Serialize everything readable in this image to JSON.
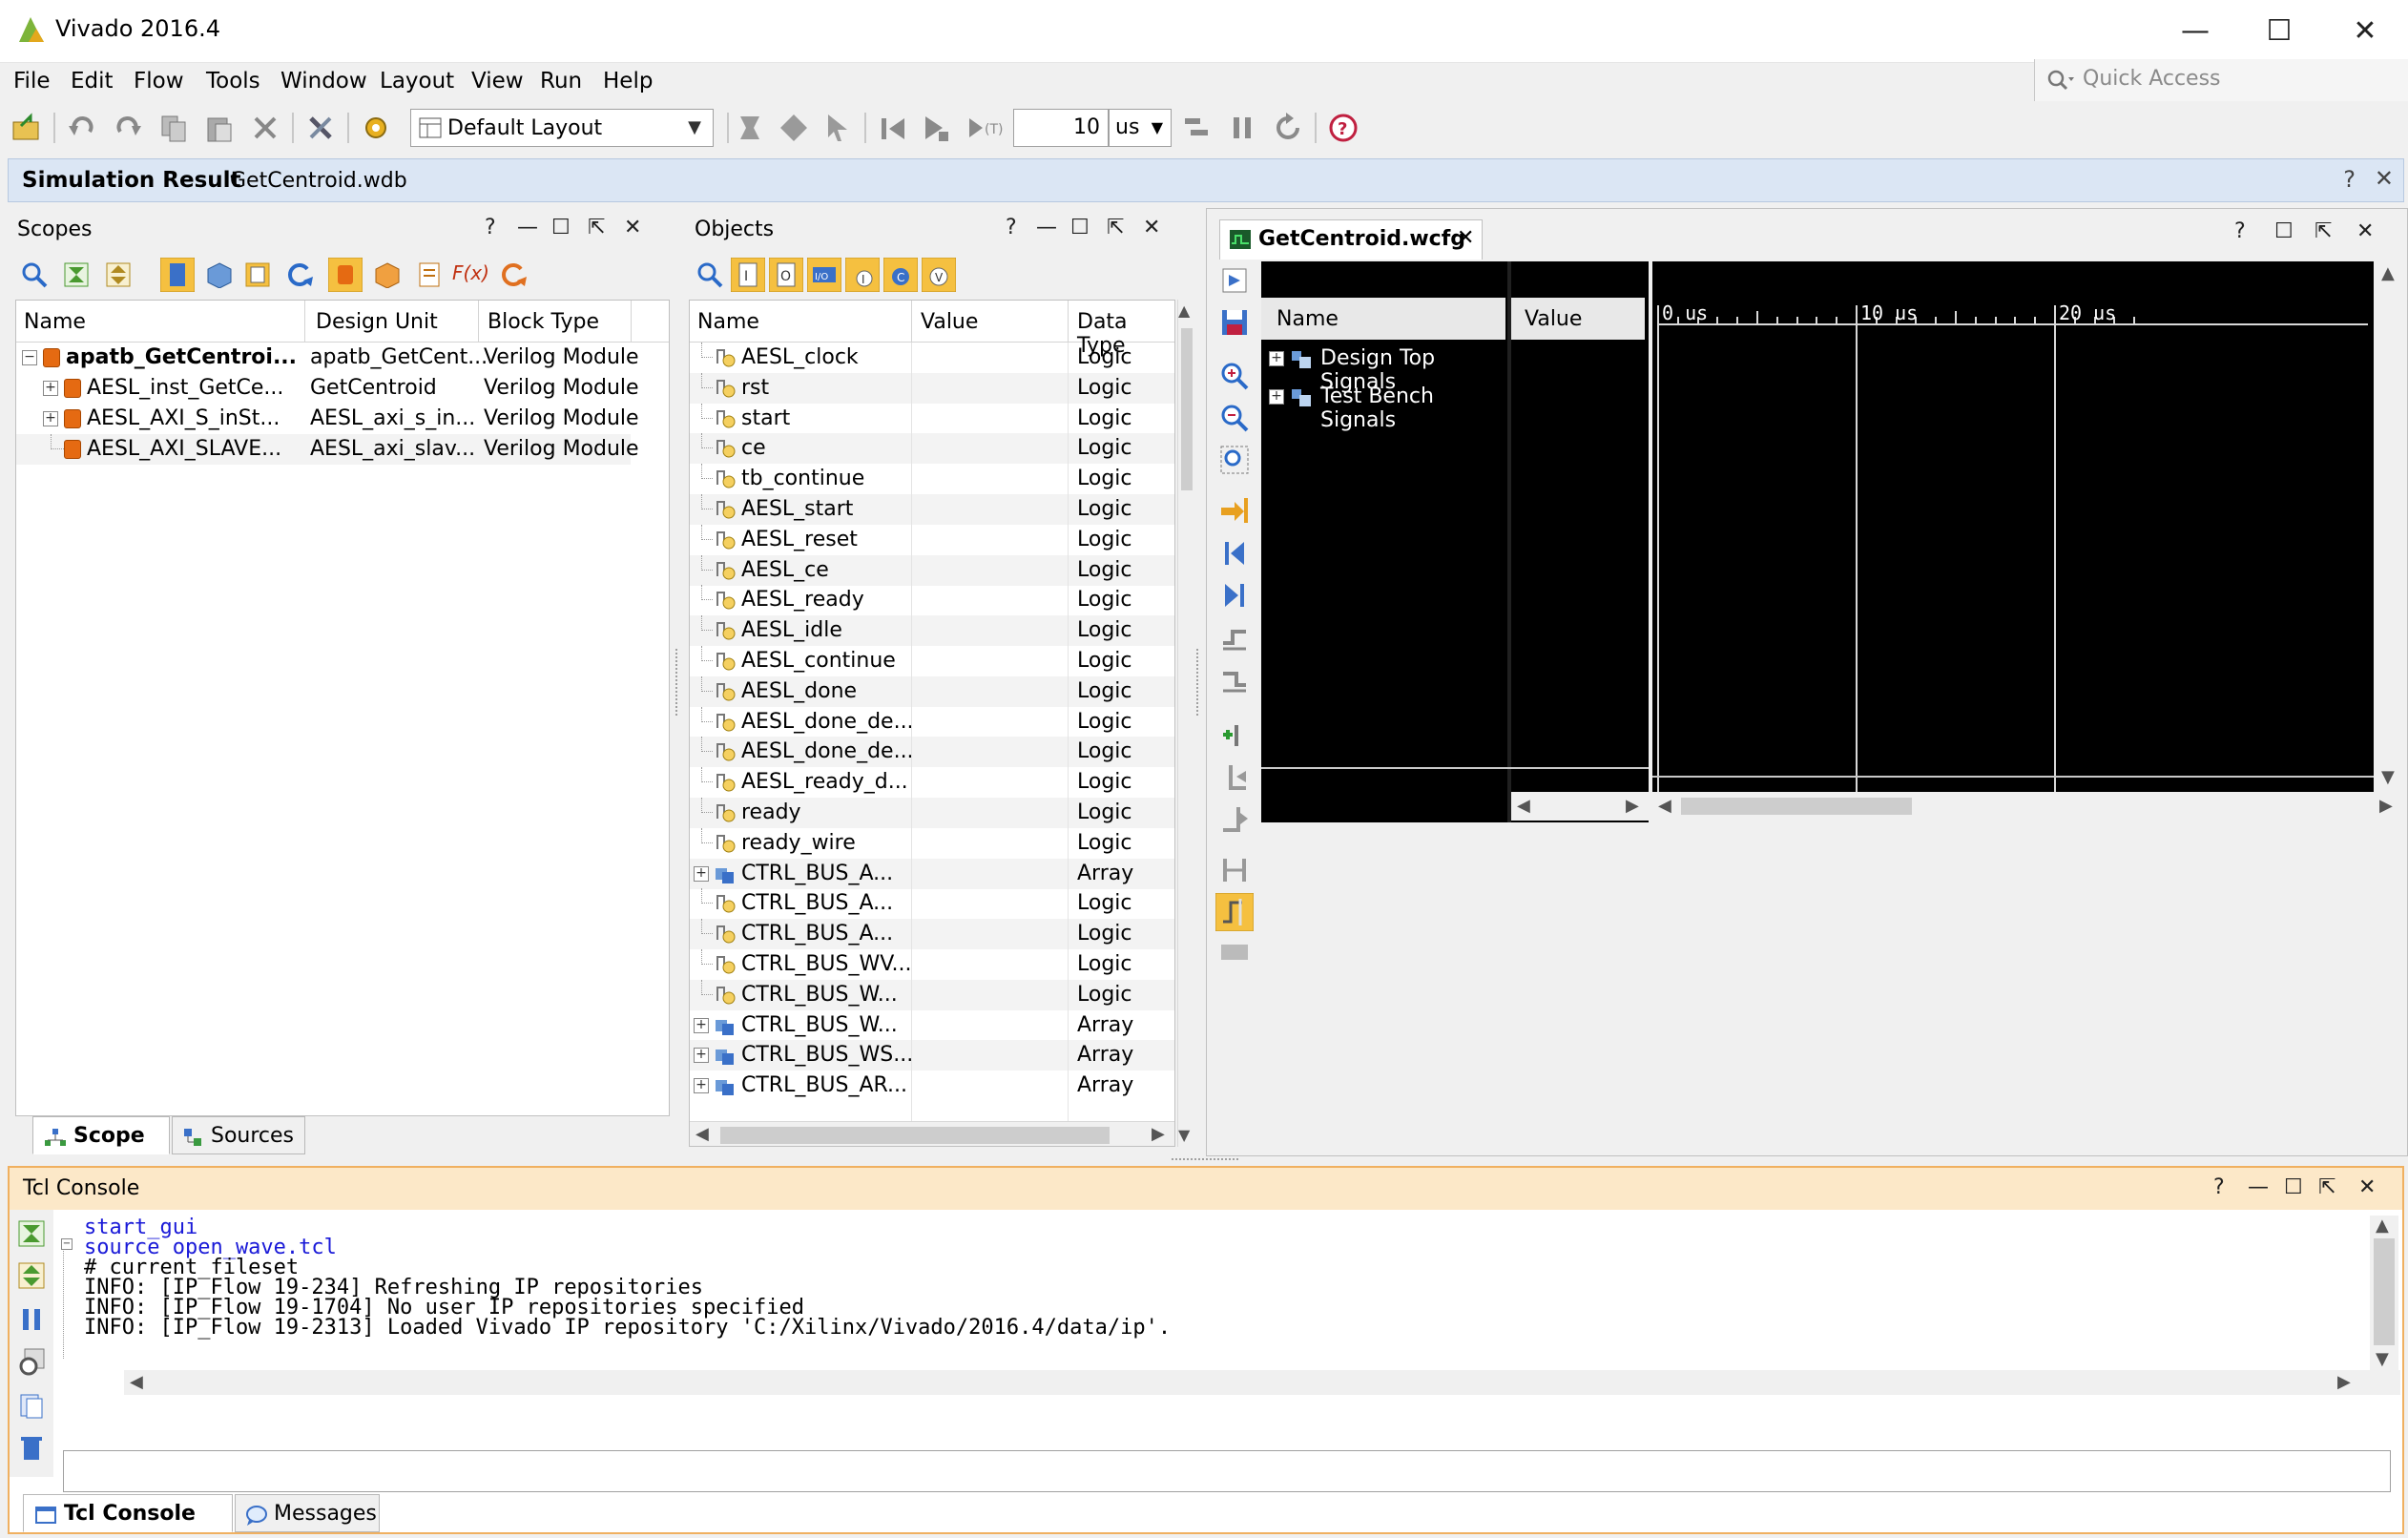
{
  "window": {
    "title": "Vivado 2016.4",
    "minimize": "—",
    "maximize": "☐",
    "close": "✕"
  },
  "menu": [
    "File",
    "Edit",
    "Flow",
    "Tools",
    "Window",
    "Layout",
    "View",
    "Run",
    "Help"
  ],
  "quick_access": {
    "placeholder": "Quick Access"
  },
  "toolbar": {
    "layout_select": "Default Layout",
    "run_time": "10",
    "run_unit": "us"
  },
  "sim_header": {
    "title": "Simulation Result",
    "file": "GetCentroid.wdb",
    "help": "?",
    "close": "✕"
  },
  "scopes": {
    "title": "Scopes",
    "columns": [
      "Name",
      "Design Unit",
      "Block Type"
    ],
    "rows": [
      {
        "name": "apatb_GetCentroi...",
        "unit": "apatb_GetCent...",
        "type": "Verilog Module",
        "toggle": "−"
      },
      {
        "name": "AESL_inst_GetCe...",
        "unit": "GetCentroid",
        "type": "Verilog Module",
        "toggle": "+"
      },
      {
        "name": "AESL_AXI_S_inSt...",
        "unit": "AESL_axi_s_in...",
        "type": "Verilog Module",
        "toggle": "+"
      },
      {
        "name": "AESL_AXI_SLAVE...",
        "unit": "AESL_axi_slav...",
        "type": "Verilog Module",
        "toggle": ""
      }
    ],
    "tabs": [
      "Scope",
      "Sources"
    ]
  },
  "objects": {
    "title": "Objects",
    "columns": [
      "Name",
      "Value",
      "Data Type"
    ],
    "rows": [
      {
        "name": "AESL_clock",
        "type": "Logic",
        "kind": "logic"
      },
      {
        "name": "rst",
        "type": "Logic",
        "kind": "logic"
      },
      {
        "name": "start",
        "type": "Logic",
        "kind": "logic"
      },
      {
        "name": "ce",
        "type": "Logic",
        "kind": "logic"
      },
      {
        "name": "tb_continue",
        "type": "Logic",
        "kind": "logic"
      },
      {
        "name": "AESL_start",
        "type": "Logic",
        "kind": "logic"
      },
      {
        "name": "AESL_reset",
        "type": "Logic",
        "kind": "logic"
      },
      {
        "name": "AESL_ce",
        "type": "Logic",
        "kind": "logic"
      },
      {
        "name": "AESL_ready",
        "type": "Logic",
        "kind": "logic"
      },
      {
        "name": "AESL_idle",
        "type": "Logic",
        "kind": "logic"
      },
      {
        "name": "AESL_continue",
        "type": "Logic",
        "kind": "logic"
      },
      {
        "name": "AESL_done",
        "type": "Logic",
        "kind": "logic"
      },
      {
        "name": "AESL_done_de...",
        "type": "Logic",
        "kind": "logic"
      },
      {
        "name": "AESL_done_de...",
        "type": "Logic",
        "kind": "logic"
      },
      {
        "name": "AESL_ready_d...",
        "type": "Logic",
        "kind": "logic"
      },
      {
        "name": "ready",
        "type": "Logic",
        "kind": "logic"
      },
      {
        "name": "ready_wire",
        "type": "Logic",
        "kind": "logic"
      },
      {
        "name": "CTRL_BUS_A...",
        "type": "Array",
        "kind": "array"
      },
      {
        "name": "CTRL_BUS_A...",
        "type": "Logic",
        "kind": "logic"
      },
      {
        "name": "CTRL_BUS_A...",
        "type": "Logic",
        "kind": "logic"
      },
      {
        "name": "CTRL_BUS_WV...",
        "type": "Logic",
        "kind": "logic"
      },
      {
        "name": "CTRL_BUS_W...",
        "type": "Logic",
        "kind": "logic"
      },
      {
        "name": "CTRL_BUS_W...",
        "type": "Array",
        "kind": "array"
      },
      {
        "name": "CTRL_BUS_WS...",
        "type": "Array",
        "kind": "array"
      },
      {
        "name": "CTRL_BUS_AR...",
        "type": "Array",
        "kind": "array"
      }
    ]
  },
  "wave": {
    "tab": "GetCentroid.wcfg",
    "columns": [
      "Name",
      "Value"
    ],
    "groups": [
      "Design Top Signals",
      "Test Bench Signals"
    ],
    "ruler": [
      "0 us",
      "10 us",
      "20 us"
    ]
  },
  "tcl": {
    "title": "Tcl Console",
    "lines": [
      {
        "text": "start_gui",
        "cmd": true
      },
      {
        "text": "source open_wave.tcl",
        "cmd": true
      },
      {
        "text": "# current_fileset",
        "cmd": false
      },
      {
        "text": "INFO: [IP_Flow 19-234] Refreshing IP repositories",
        "cmd": false
      },
      {
        "text": "INFO: [IP_Flow 19-1704] No user IP repositories specified",
        "cmd": false
      },
      {
        "text": "INFO: [IP_Flow 19-2313] Loaded Vivado IP repository 'C:/Xilinx/Vivado/2016.4/data/ip'.",
        "cmd": false
      }
    ],
    "input_value": "",
    "tabs": [
      "Tcl Console",
      "Messages"
    ]
  }
}
